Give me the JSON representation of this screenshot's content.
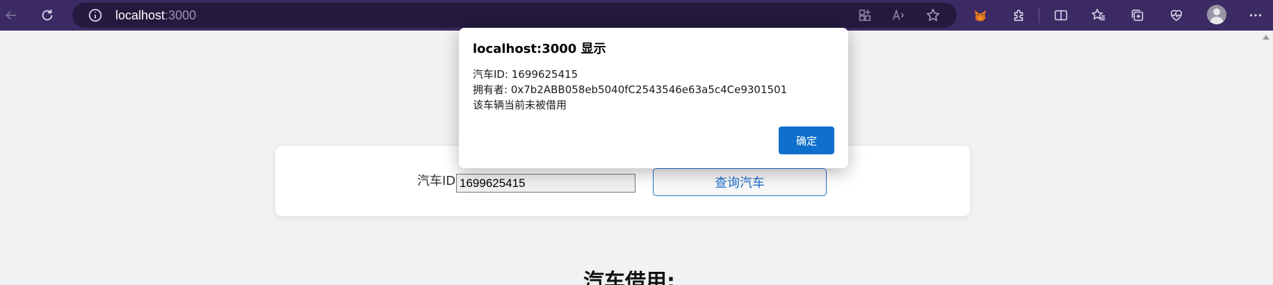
{
  "browser": {
    "address": {
      "host": "localhost",
      "port": ":3000"
    },
    "icons": {
      "back": "arrow-left-icon",
      "reload": "reload-icon",
      "info": "info-icon",
      "apps": "apps-icon",
      "read_aloud": "read-aloud-icon",
      "favorite": "star-icon",
      "extension_metamask": "metamask-fox-icon",
      "extensions": "puzzle-icon",
      "split_screen": "split-screen-icon",
      "favorites": "favorites-icon",
      "collections": "collections-icon",
      "browser_essentials": "heart-pulse-icon",
      "profile": "avatar-icon",
      "more": "more-icon"
    },
    "colors": {
      "toolbar": "#3b2a63",
      "address_bar": "#241a3e"
    }
  },
  "page": {
    "card": {
      "car_id_label": "汽车ID:",
      "car_id_value": "1699625415",
      "query_button": "查询汽车"
    },
    "section_title": "汽车借用:"
  },
  "dialog": {
    "title": "localhost:3000 显示",
    "lines": [
      "汽车ID: 1699625415",
      "拥有者: 0x7b2ABB058eb5040fC2543546e63a5c4Ce9301501",
      "该车辆当前未被借用"
    ],
    "ok_button": "确定",
    "colors": {
      "ok_button": "#0f6fcc"
    }
  }
}
